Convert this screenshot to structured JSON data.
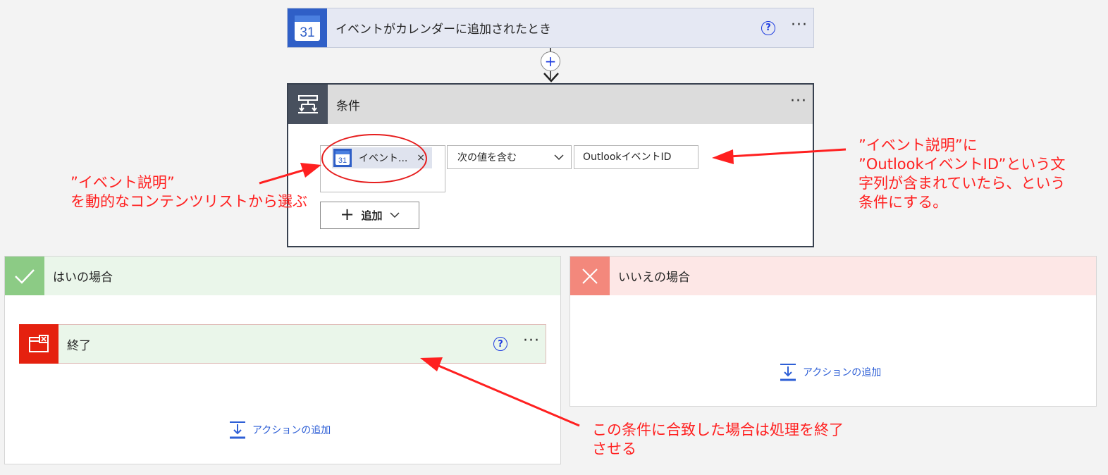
{
  "trigger": {
    "title": "イベントがカレンダーに追加されたとき",
    "calendar_day": "31",
    "help": "?",
    "more": "···"
  },
  "connector": {
    "insert": "+"
  },
  "condition": {
    "title": "条件",
    "more": "···",
    "left_token": {
      "label": "イベント...",
      "calendar_day": "31",
      "remove": "×"
    },
    "operator": "次の値を含む",
    "right_value": "OutlookイベントID",
    "add_label": "追加"
  },
  "yes_branch": {
    "title": "はいの場合",
    "terminate": {
      "title": "終了",
      "help": "?",
      "more": "···"
    },
    "add_action": "アクションの追加"
  },
  "no_branch": {
    "title": "いいえの場合",
    "add_action": "アクションの追加"
  },
  "annotations": {
    "left": [
      "”イベント説明”",
      "を動的なコンテンツリストから選ぶ"
    ],
    "right": [
      "”イベント説明”に",
      "”OutlookイベントID”という文",
      "字列が含まれていたら、という",
      "条件にする。"
    ],
    "bottom": [
      "この条件に合致した場合は処理を終了",
      "させる"
    ]
  },
  "colors": {
    "annotation": "#ff2020",
    "link": "#2e5fd6",
    "yes_header": "#eaf6ea",
    "no_header": "#fde7e6",
    "terminate": "#e5210f"
  }
}
